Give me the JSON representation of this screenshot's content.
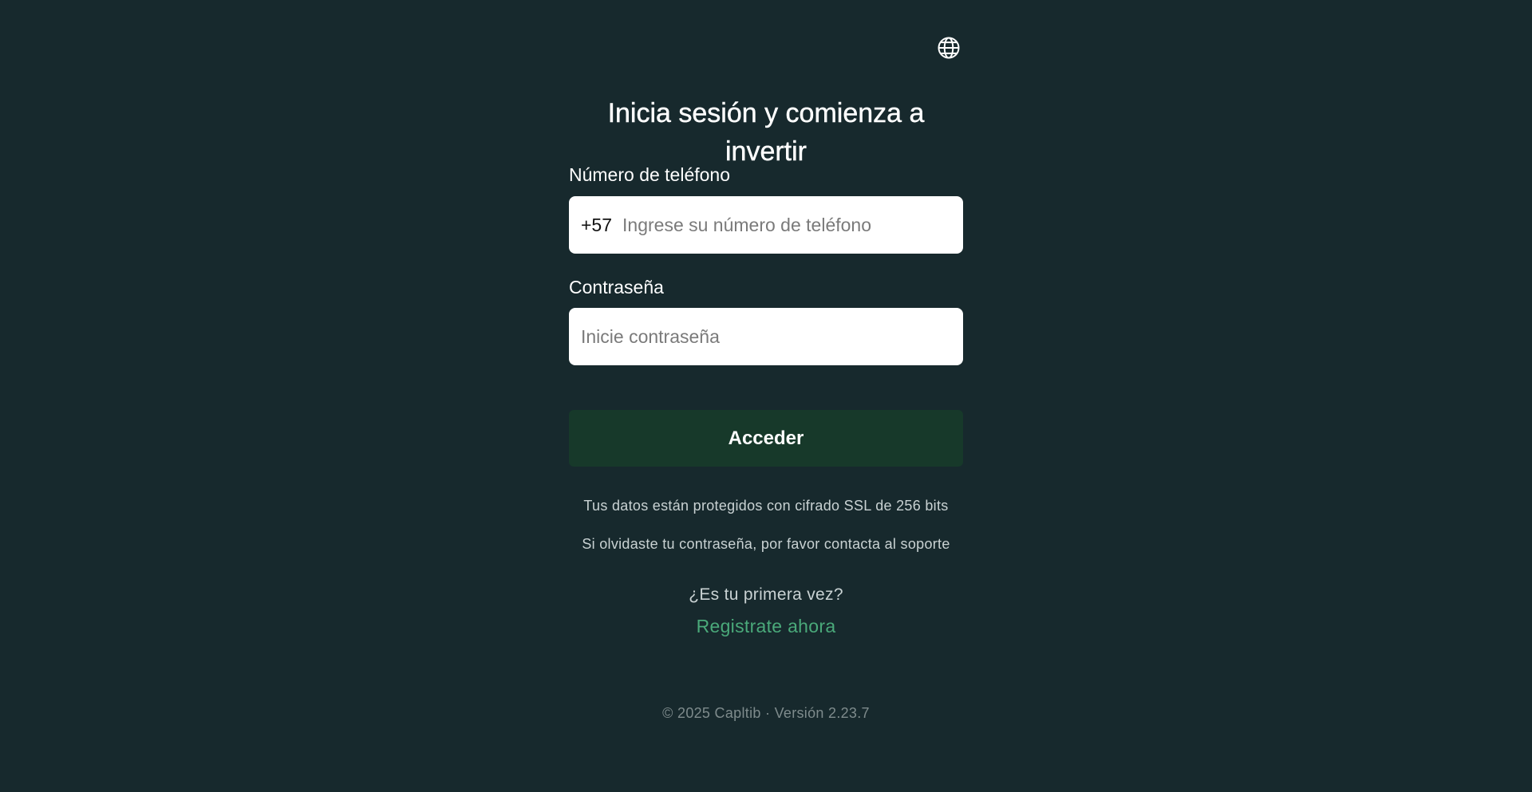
{
  "header": {
    "language_icon": "globe-icon",
    "title": "Inicia sesión y comienza a invertir"
  },
  "form": {
    "phone": {
      "label": "Número de teléfono",
      "prefix": "+57",
      "value": "",
      "placeholder": "Ingrese su número de teléfono"
    },
    "password": {
      "label": "Contraseña",
      "value": "",
      "placeholder": "Inicie contraseña"
    },
    "submit_label": "Acceder"
  },
  "notes": {
    "ssl": "Tus datos están protegidos con cifrado SSL de 256 bits",
    "forgot": "Si olvidaste tu contraseña, por favor contacta al soporte"
  },
  "signup": {
    "question": "¿Es tu primera vez?",
    "link_label": "Registrate ahora"
  },
  "footer": {
    "text": "© 2025 Capltib · Versión 2.23.7"
  },
  "colors": {
    "background": "#17292d",
    "button": "#17392a",
    "link": "#4aa97a",
    "input_background": "#ffffff"
  }
}
